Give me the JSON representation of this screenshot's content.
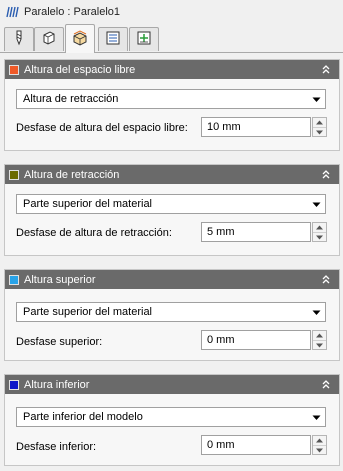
{
  "window": {
    "title": "Paralelo : Paralelo1",
    "app_icon": "parallel-toolpath-icon"
  },
  "tabs": [
    {
      "icon": "tool-icon",
      "active": false
    },
    {
      "icon": "geometry-icon",
      "active": false
    },
    {
      "icon": "heights-icon",
      "active": true
    },
    {
      "icon": "passes-icon",
      "active": false
    },
    {
      "icon": "linking-icon",
      "active": false
    }
  ],
  "sections": [
    {
      "title": "Altura del espacio libre",
      "color": "#f05a28",
      "select_value": "Altura de retracción",
      "offset_label": "Desfase de altura del espacio libre:",
      "offset_value": "10 mm"
    },
    {
      "title": "Altura de retracción",
      "color": "#6b6a00",
      "select_value": "Parte superior del material",
      "offset_label": "Desfase de altura de retracción:",
      "offset_value": "5 mm"
    },
    {
      "title": "Altura superior",
      "color": "#29a3e8",
      "select_value": "Parte superior del material",
      "offset_label": "Desfase superior:",
      "offset_value": "0 mm"
    },
    {
      "title": "Altura inferior",
      "color": "#0a14c8",
      "select_value": "Parte inferior del modelo",
      "offset_label": "Desfase inferior:",
      "offset_value": "0 mm"
    }
  ]
}
